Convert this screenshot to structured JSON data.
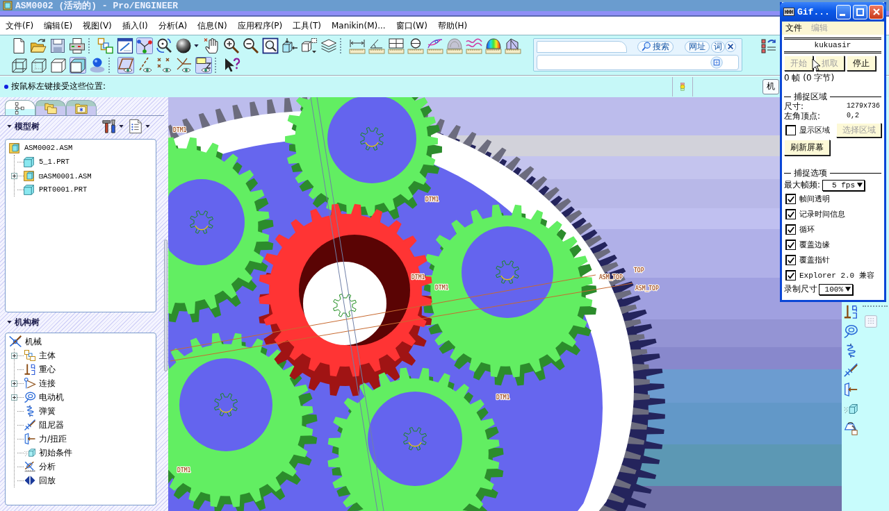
{
  "window": {
    "title": "ASM0002 (活动的) - Pro/ENGINEER"
  },
  "menu": [
    "文件(F)",
    "编辑(E)",
    "视图(V)",
    "插入(I)",
    "分析(A)",
    "信息(N)",
    "应用程序(P)",
    "工具(T)",
    "Manikin(M)...",
    "窗口(W)",
    "帮助(H)"
  ],
  "toolbar": {
    "row_1": [
      {
        "on": false
      },
      {
        "on": false
      },
      {
        "on": false
      },
      {
        "on": false
      },
      {
        "on": false
      },
      {
        "on": false
      },
      {
        "on": true
      },
      {
        "on": false
      },
      {
        "on": false
      },
      {
        "on": false
      },
      {
        "on": false
      },
      {
        "on": false
      },
      {
        "on": false
      },
      {
        "on": false
      },
      {
        "on": false
      },
      {
        "on": false
      },
      {
        "on": false
      },
      {
        "on": false
      },
      {
        "on": false
      },
      {
        "on": false
      },
      {
        "on": false
      },
      {
        "on": false
      },
      {
        "on": false
      },
      {
        "on": false
      },
      {
        "on": false
      }
    ],
    "row_2": [
      {
        "on": false
      },
      {
        "on": false
      },
      {
        "on": false
      },
      {
        "on": true
      },
      {
        "on": false
      },
      {
        "on": true
      },
      {
        "on": false
      },
      {
        "on": false
      },
      {
        "on": false
      },
      {
        "on": true
      },
      {
        "on": false
      }
    ]
  },
  "search_bar": {
    "buttons": [
      "搜索",
      "网址",
      "词"
    ]
  },
  "message_line": {
    "text": "按鼠标左键接受这些位置:",
    "mode_button": "机"
  },
  "left_panel": {
    "tabs": [
      {
        "selected": true
      },
      {
        "selected": false
      },
      {
        "selected": false
      }
    ],
    "model_tree": {
      "title": "模型树",
      "items": [
        {
          "label": "ASM0002.ASM",
          "kind": "assembly",
          "collapsed": false,
          "children": [
            {
              "label": "5_1.PRT",
              "kind": "part",
              "collapsed": false
            },
            {
              "label": "⊡ASM0001.ASM",
              "kind": "assembly",
              "collapsed": true
            },
            {
              "label": "PRT0001.PRT",
              "kind": "part",
              "collapsed": false
            }
          ]
        }
      ]
    },
    "mechanism_tree": {
      "title": "机构树",
      "items": [
        {
          "label": "机械",
          "collapsed": false,
          "children": [
            {
              "label": "主体",
              "collapsed": true
            },
            {
              "label": "重心",
              "collapsed": false
            },
            {
              "label": "连接",
              "collapsed": true
            },
            {
              "label": "电动机",
              "collapsed": true
            },
            {
              "label": "弹簧",
              "collapsed": false
            },
            {
              "label": "阻尼器",
              "collapsed": false
            },
            {
              "label": "力/扭距",
              "collapsed": false
            },
            {
              "label": "初始条件",
              "collapsed": false
            },
            {
              "label": "分析",
              "collapsed": false
            },
            {
              "label": "回放",
              "collapsed": false
            }
          ]
        }
      ]
    }
  },
  "viewport": {
    "datum_labels": [
      "DTM1",
      "DTM1",
      "DTM1",
      "DTM1",
      "DTM1",
      "DTM1",
      "ASM_TOP",
      "TOP",
      "ASM_TOP"
    ]
  },
  "gif_window": {
    "title": "Gif...",
    "menu": [
      {
        "label": "文件",
        "disabled": false
      },
      {
        "label": "编辑",
        "disabled": true
      }
    ],
    "name": "kukuasir",
    "buttons": [
      {
        "label": "开始",
        "disabled": true
      },
      {
        "label": "抓取",
        "disabled": true
      },
      {
        "label": "停止",
        "disabled": false
      }
    ],
    "frame_info": "0 帧 (0 字节)",
    "capture_area": {
      "title": "捕捉区域",
      "size_label": "尺寸:",
      "size_value": "1279x736",
      "corner_label": "左角顶点:",
      "corner_value": "0,2",
      "show_area": {
        "label": "显示区域",
        "checked": false
      },
      "select_button": {
        "label": "选择区域",
        "disabled": true
      },
      "refresh_button": "刷新屏幕"
    },
    "capture_options": {
      "title": "捕捉选项",
      "max_rate_label": "最大帧频:",
      "max_rate_value": "5 fps",
      "options": [
        {
          "label": "帧间透明",
          "checked": true
        },
        {
          "label": "记录时间信息",
          "checked": true
        },
        {
          "label": "循环",
          "checked": true
        },
        {
          "label": "覆盖边缘",
          "checked": true
        },
        {
          "label": "覆盖指针",
          "checked": true
        },
        {
          "label": "Explorer 2.0 兼容",
          "checked": true
        }
      ],
      "record_size_label": "录制尺寸",
      "record_size_value": "100%"
    }
  }
}
